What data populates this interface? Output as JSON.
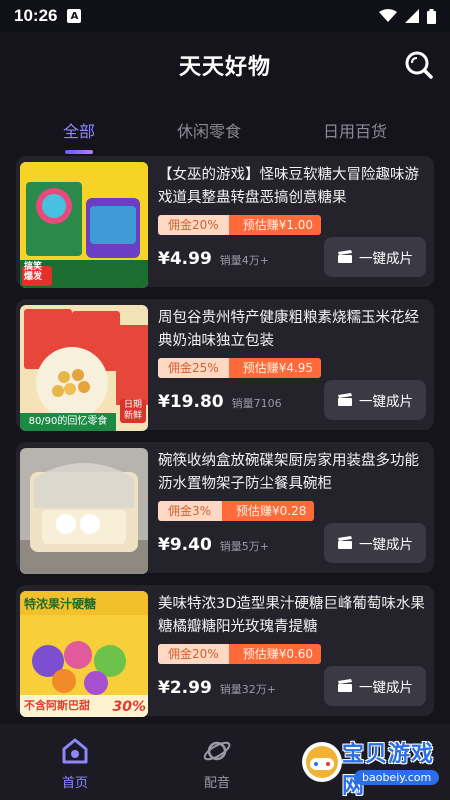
{
  "status": {
    "time": "10:26"
  },
  "header": {
    "title": "天天好物"
  },
  "tabs": [
    {
      "label": "全部"
    },
    {
      "label": "休闲零食"
    },
    {
      "label": "日用百货"
    }
  ],
  "products": [
    {
      "title": "【女巫的游戏】怪味豆软糖大冒险趣味游戏道具整蛊转盘恶搞创意糖果",
      "commission": "佣金20%",
      "earn": "预估赚¥1.00",
      "price": "¥4.99",
      "sales": "销量4万+",
      "button": "一键成片",
      "image_text": "搞笑爆发"
    },
    {
      "title": "周包谷贵州特产健康粗粮素烧糯玉米花经典奶油味独立包装",
      "commission": "佣金25%",
      "earn": "预估赚¥4.95",
      "price": "¥19.80",
      "sales": "销量7106",
      "button": "一键成片",
      "image_text": "80/90的回忆零食",
      "image_badge": "日期新鲜"
    },
    {
      "title": "碗筷收纳盒放碗碟架厨房家用装盘多功能沥水置物架子防尘餐具碗柜",
      "commission": "佣金3%",
      "earn": "预估赚¥0.28",
      "price": "¥9.40",
      "sales": "销量5万+",
      "button": "一键成片"
    },
    {
      "title": "美味特浓3D造型果汁硬糖巨峰葡萄味水果糖橘瓣糖阳光玫瑰青提糖",
      "commission": "佣金20%",
      "earn": "预估赚¥0.60",
      "price": "¥2.99",
      "sales": "销量32万+",
      "button": "一键成片",
      "image_text": "特浓果汁硬糖",
      "image_footer": "不含阿斯巴甜",
      "image_percent": "30%"
    }
  ],
  "bottom_nav": [
    {
      "label": "首页",
      "icon": "home-icon"
    },
    {
      "label": "配音",
      "icon": "planet-icon"
    }
  ],
  "watermark": {
    "text": "宝贝游戏网",
    "url": "baobeiy.com"
  }
}
